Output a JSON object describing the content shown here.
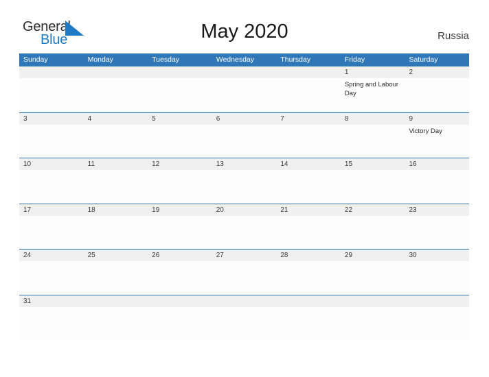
{
  "header": {
    "logo": {
      "word_one": "General",
      "word_two": "Blue",
      "triangle_color": "#1f7ac4",
      "word_one_color": "#2b2b2b",
      "word_two_color": "#1f7ac4"
    },
    "title": "May 2020",
    "country": "Russia"
  },
  "theme": {
    "header_blue": "#3077b8",
    "row_rule_blue": "#2e6da4",
    "day_band_gray": "#f0f0f0",
    "cell_background": "#fdfdfd",
    "text_dark": "#3c3c3c"
  },
  "calendar": {
    "weekdays": [
      "Sunday",
      "Monday",
      "Tuesday",
      "Wednesday",
      "Thursday",
      "Friday",
      "Saturday"
    ],
    "weeks": [
      [
        {
          "day": "",
          "events": []
        },
        {
          "day": "",
          "events": []
        },
        {
          "day": "",
          "events": []
        },
        {
          "day": "",
          "events": []
        },
        {
          "day": "",
          "events": []
        },
        {
          "day": "1",
          "events": [
            "Spring and Labour Day"
          ]
        },
        {
          "day": "2",
          "events": []
        }
      ],
      [
        {
          "day": "3",
          "events": []
        },
        {
          "day": "4",
          "events": []
        },
        {
          "day": "5",
          "events": []
        },
        {
          "day": "6",
          "events": []
        },
        {
          "day": "7",
          "events": []
        },
        {
          "day": "8",
          "events": []
        },
        {
          "day": "9",
          "events": [
            "Victory Day"
          ]
        }
      ],
      [
        {
          "day": "10",
          "events": []
        },
        {
          "day": "11",
          "events": []
        },
        {
          "day": "12",
          "events": []
        },
        {
          "day": "13",
          "events": []
        },
        {
          "day": "14",
          "events": []
        },
        {
          "day": "15",
          "events": []
        },
        {
          "day": "16",
          "events": []
        }
      ],
      [
        {
          "day": "17",
          "events": []
        },
        {
          "day": "18",
          "events": []
        },
        {
          "day": "19",
          "events": []
        },
        {
          "day": "20",
          "events": []
        },
        {
          "day": "21",
          "events": []
        },
        {
          "day": "22",
          "events": []
        },
        {
          "day": "23",
          "events": []
        }
      ],
      [
        {
          "day": "24",
          "events": []
        },
        {
          "day": "25",
          "events": []
        },
        {
          "day": "26",
          "events": []
        },
        {
          "day": "27",
          "events": []
        },
        {
          "day": "28",
          "events": []
        },
        {
          "day": "29",
          "events": []
        },
        {
          "day": "30",
          "events": []
        }
      ],
      [
        {
          "day": "31",
          "events": []
        },
        {
          "day": "",
          "events": []
        },
        {
          "day": "",
          "events": []
        },
        {
          "day": "",
          "events": []
        },
        {
          "day": "",
          "events": []
        },
        {
          "day": "",
          "events": []
        },
        {
          "day": "",
          "events": []
        }
      ]
    ]
  }
}
